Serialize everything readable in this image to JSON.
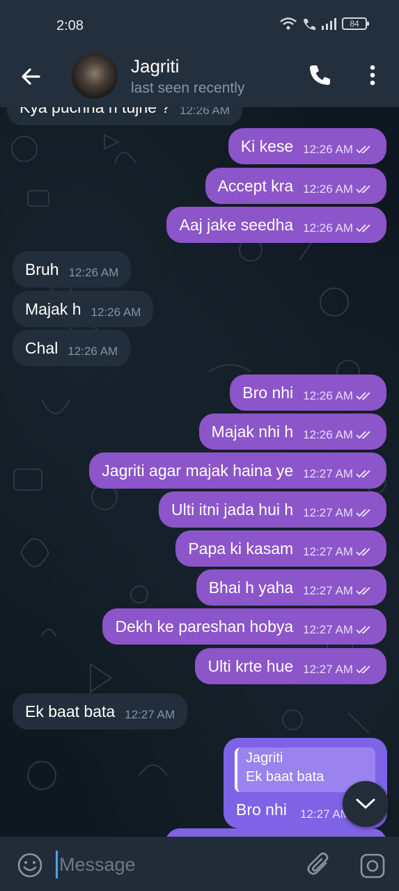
{
  "status_bar": {
    "time": "2:08",
    "battery": "84"
  },
  "header": {
    "contact_name": "Jagriti",
    "contact_status": "last seen recently"
  },
  "messages": [
    {
      "dir": "in",
      "text": "Kya puchna h tujhe ?",
      "time": "12:26 AM"
    },
    {
      "dir": "out",
      "text": "Ki kese",
      "time": "12:26 AM"
    },
    {
      "dir": "out",
      "text": "Accept kra",
      "time": "12:26 AM"
    },
    {
      "dir": "out",
      "text": "Aaj jake seedha",
      "time": "12:26 AM"
    },
    {
      "dir": "in",
      "text": "Bruh",
      "time": "12:26 AM"
    },
    {
      "dir": "in",
      "text": "Majak h",
      "time": "12:26 AM"
    },
    {
      "dir": "in",
      "text": "Chal",
      "time": "12:26 AM"
    },
    {
      "dir": "out",
      "text": "Bro nhi",
      "time": "12:26 AM"
    },
    {
      "dir": "out",
      "text": "Majak nhi h",
      "time": "12:26 AM"
    },
    {
      "dir": "out",
      "text": "Jagriti agar majak haina ye",
      "time": "12:27 AM"
    },
    {
      "dir": "out",
      "text": "Ulti itni jada hui h",
      "time": "12:27 AM"
    },
    {
      "dir": "out",
      "text": "Papa ki kasam",
      "time": "12:27 AM"
    },
    {
      "dir": "out",
      "text": "Bhai h yaha",
      "time": "12:27 AM"
    },
    {
      "dir": "out",
      "text": "Dekh ke pareshan hobya",
      "time": "12:27 AM"
    },
    {
      "dir": "out",
      "text": "Ulti krte hue",
      "time": "12:27 AM"
    },
    {
      "dir": "in",
      "text": "Ek baat bata",
      "time": "12:27 AM"
    }
  ],
  "reply_message": {
    "quote_name": "Jagriti",
    "quote_text": "Ek baat bata",
    "text": "Bro nhi",
    "time": "12:27 AM"
  },
  "input": {
    "placeholder": "Message"
  },
  "colors": {
    "outgoing_bubble": "#8c55c9",
    "incoming_bubble": "#232e3c",
    "header_bg": "#242f3d",
    "chat_bg": "#0f1820"
  },
  "icons": {
    "back": "arrow-left-icon",
    "call": "phone-icon",
    "menu": "more-vertical-icon",
    "emoji": "smiley-icon",
    "attach": "paperclip-icon",
    "camera": "camera-icon",
    "scroll": "chevron-down-icon"
  }
}
